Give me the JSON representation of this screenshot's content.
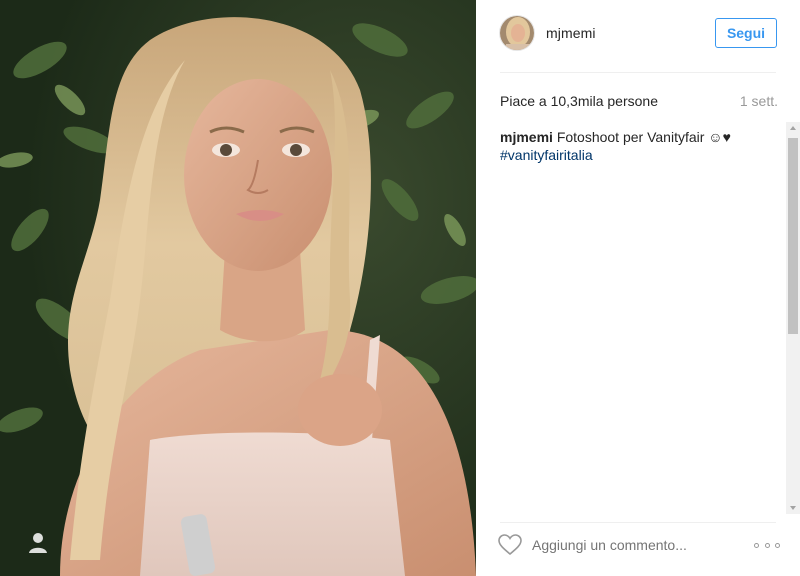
{
  "post": {
    "username": "mjmemi",
    "follow_label": "Segui",
    "likes_text": "Piace a 10,3mila persone",
    "time_text": "1 sett.",
    "caption_user": "mjmemi",
    "caption_text": "Fotoshoot per Vanityfair ☺︎♥",
    "caption_hashtag": "#vanityfairitalia",
    "comment_placeholder": "Aggiungi un commento...",
    "more_icon": "more-options-icon",
    "like_icon": "heart-icon"
  },
  "colors": {
    "accent": "#3897f0",
    "hashtag": "#003569",
    "muted": "#999999",
    "text": "#262626"
  }
}
